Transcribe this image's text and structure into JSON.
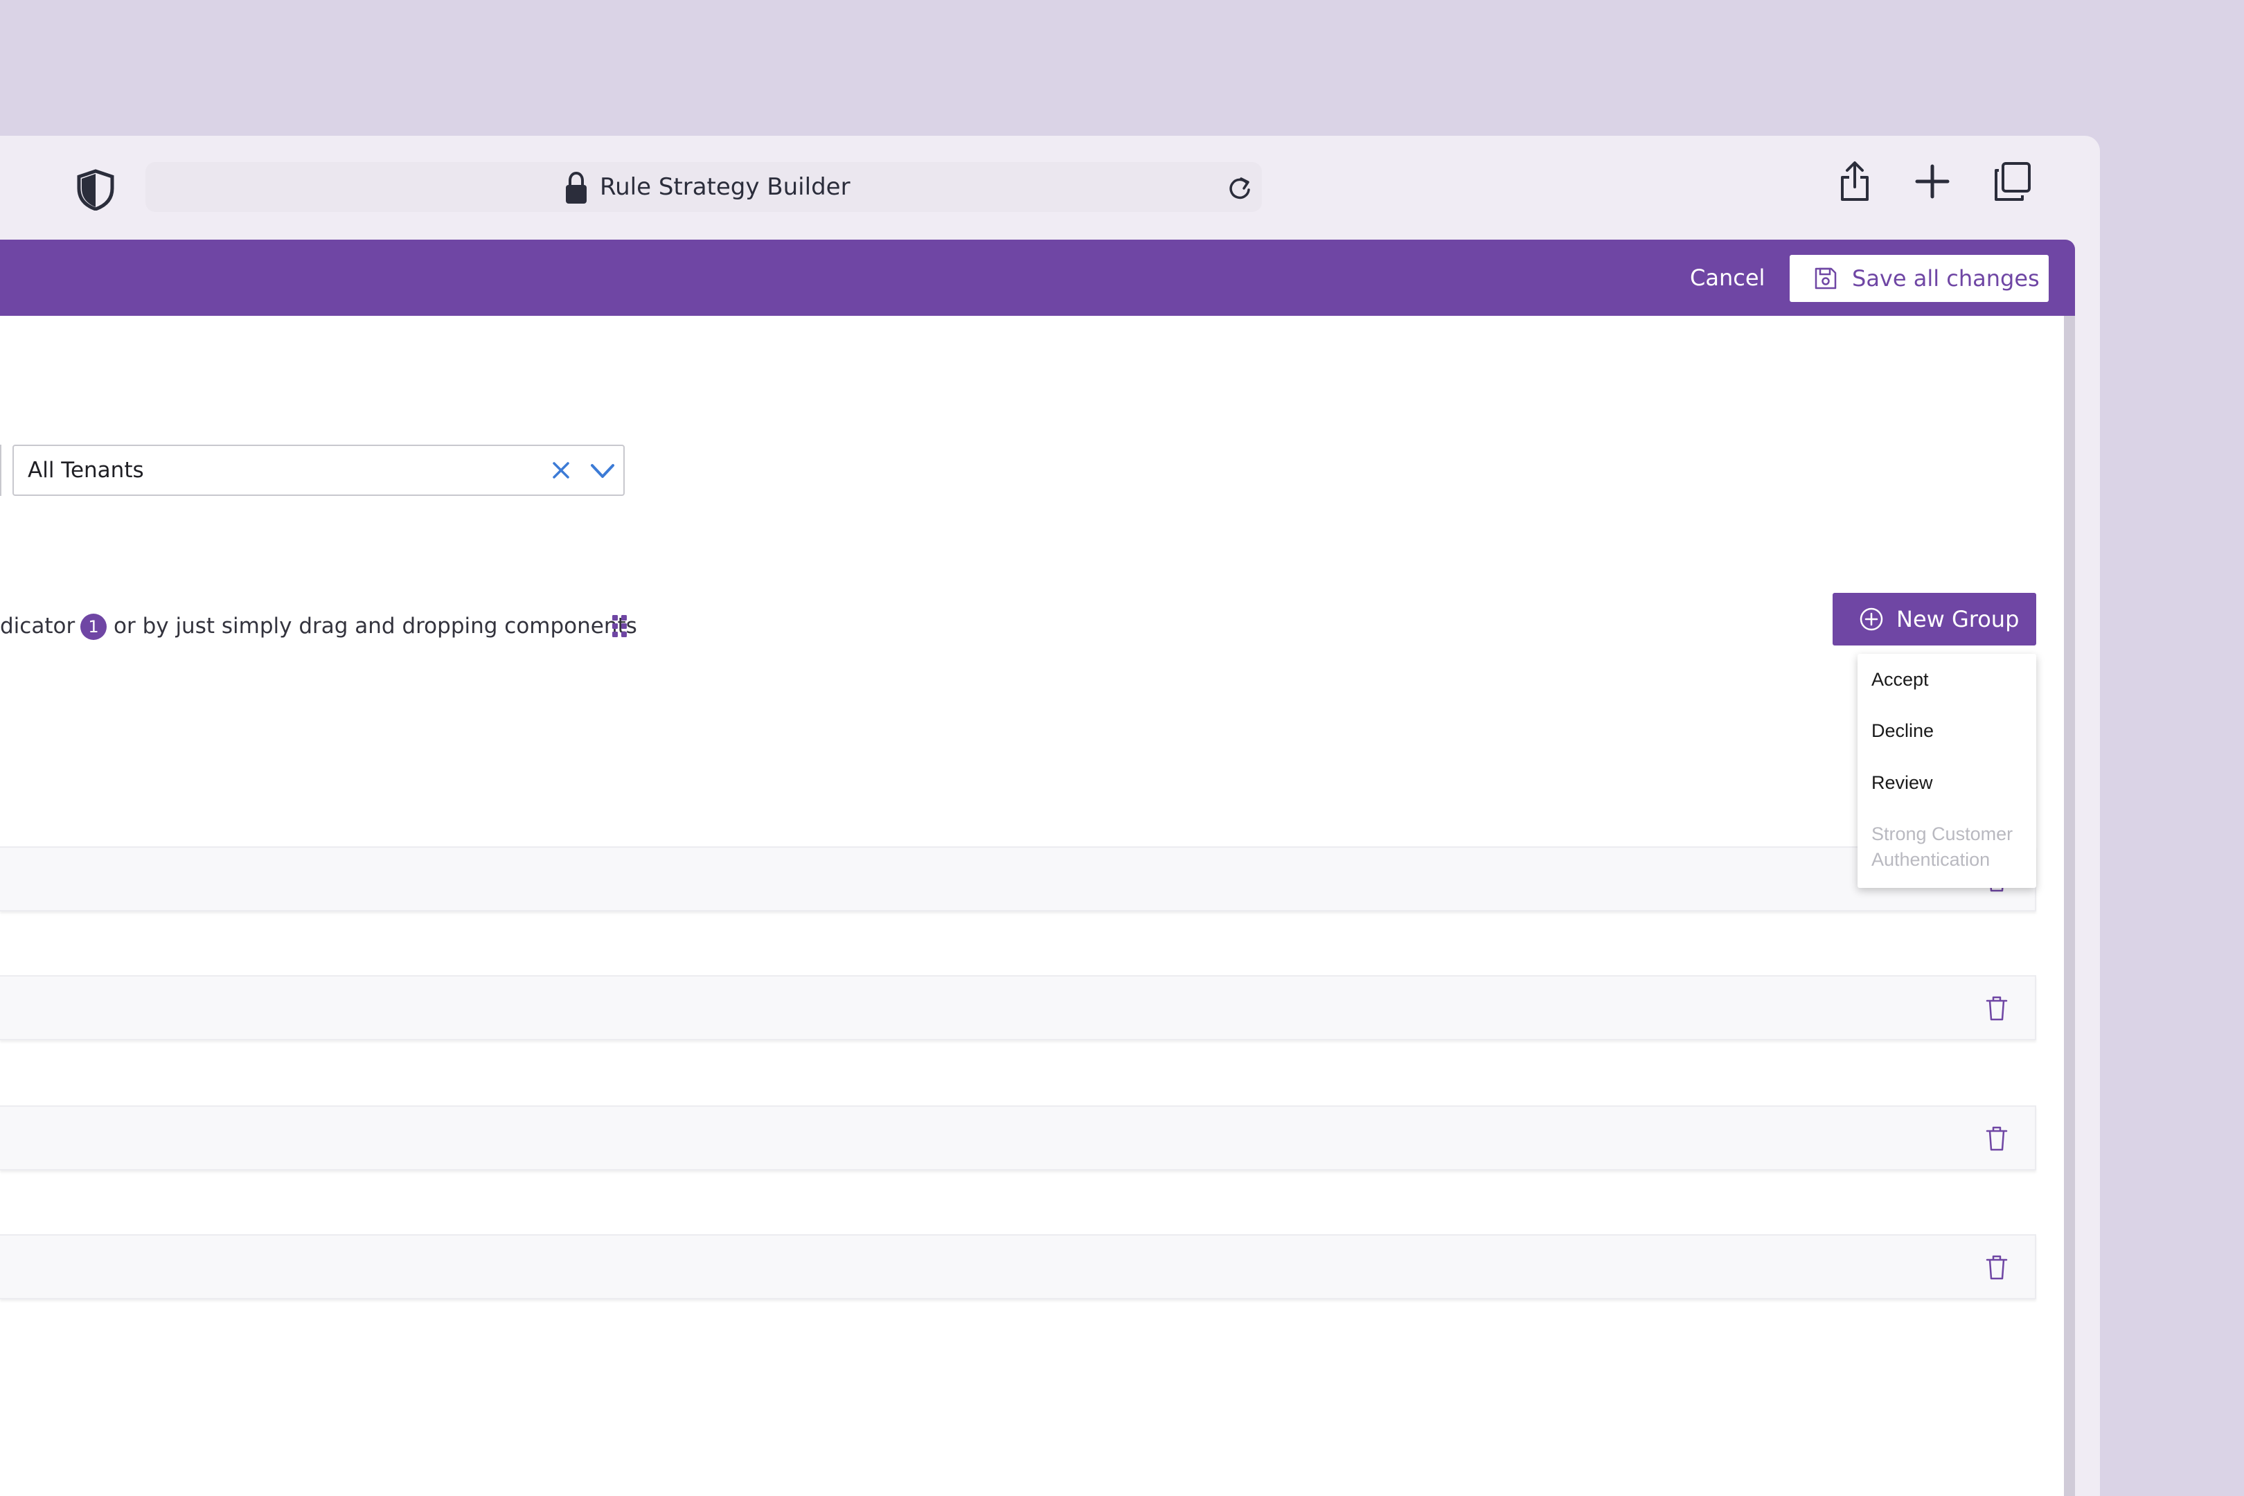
{
  "browser": {
    "address_title": "Rule Strategy Builder"
  },
  "header": {
    "cancel_label": "Cancel",
    "save_label": "Save all changes"
  },
  "filters": {
    "tenant_value": "All Tenants"
  },
  "instructions": {
    "text_before_badge": "dicator",
    "badge_number": "1",
    "text_after_badge": "or by just simply drag and dropping components"
  },
  "actions": {
    "new_group_label": "New Group"
  },
  "new_group_menu": {
    "items": [
      {
        "label": "Accept",
        "enabled": true
      },
      {
        "label": "Decline",
        "enabled": true
      },
      {
        "label": "Review",
        "enabled": true
      },
      {
        "label": "Strong Customer Authentication",
        "enabled": false
      }
    ]
  },
  "colors": {
    "accent": "#6f46a4",
    "page_background": "#dad3e6",
    "window_chrome": "#f0ecf4",
    "clear_icon": "#3c7bd6",
    "disabled_text": "#b9b9c0"
  },
  "icons": {
    "toolbar": [
      "shield-icon",
      "lock-icon",
      "reload-icon",
      "share-icon",
      "plus-icon",
      "tabs-icon"
    ],
    "content": [
      "save-icon",
      "clear-icon",
      "chevron-down-icon",
      "drag-handle-icon",
      "add-circle-icon",
      "trash-icon"
    ]
  }
}
